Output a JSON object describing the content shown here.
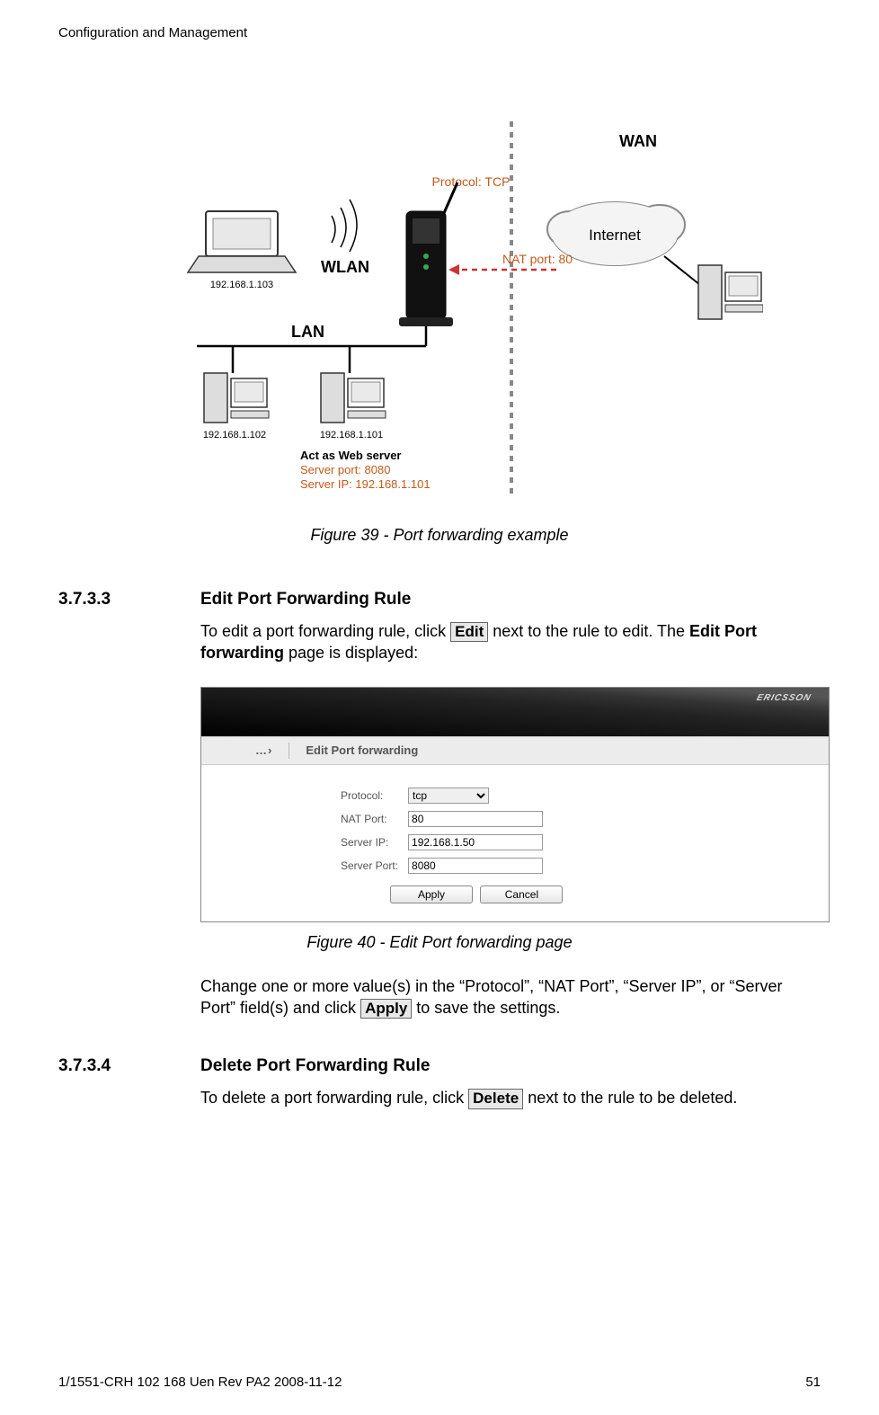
{
  "header": "Configuration and Management",
  "diagram": {
    "wan": "WAN",
    "internet": "Internet",
    "protocol": "Protocol: TCP",
    "natport": "NAT port: 80",
    "wlan": "WLAN",
    "lan": "LAN",
    "laptop_ip": "192.168.1.103",
    "pc1_ip": "192.168.1.102",
    "pc2_ip": "192.168.1.101",
    "act_as": "Act as Web server",
    "server_port": "Server port: 8080",
    "server_ip": "Server IP: 192.168.1.101"
  },
  "fig39_caption": "Figure 39 - Port forwarding example",
  "sec3733": {
    "num": "3.7.3.3",
    "title": "Edit Port Forwarding Rule",
    "para_pre": "To edit a port forwarding rule, click ",
    "btn": "Edit",
    "para_mid": " next to the rule to edit. The ",
    "bold": "Edit Port forwarding",
    "para_post": " page is displayed:"
  },
  "screenshot": {
    "brand": "ERICSSON",
    "breadcrumb_arrow": "…›",
    "breadcrumb": "Edit Port forwarding",
    "labels": {
      "protocol": "Protocol:",
      "nat_port": "NAT Port:",
      "server_ip": "Server IP:",
      "server_port": "Server Port:"
    },
    "values": {
      "protocol": "tcp",
      "nat_port": "80",
      "server_ip": "192.168.1.50",
      "server_port": "8080"
    },
    "buttons": {
      "apply": "Apply",
      "cancel": "Cancel"
    }
  },
  "fig40_caption": "Figure 40 - Edit Port forwarding page",
  "change_para": {
    "pre": "Change one or more value(s) in the “Protocol”, “NAT Port”, “Server IP”, or “Server Port” field(s) and click ",
    "btn": "Apply",
    "post": " to save the settings."
  },
  "sec3734": {
    "num": "3.7.3.4",
    "title": "Delete Port Forwarding Rule",
    "para_pre": "To delete a port forwarding rule, click ",
    "btn": "Delete",
    "para_post": " next to the rule to be deleted."
  },
  "footer": {
    "left": "1/1551-CRH 102 168 Uen Rev PA2  2008-11-12",
    "right": "51"
  }
}
